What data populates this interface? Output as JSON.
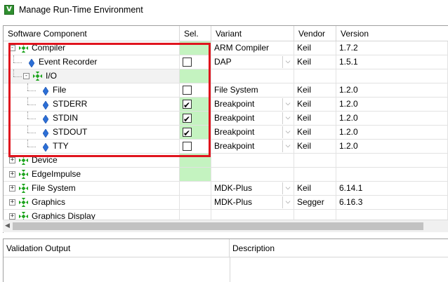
{
  "window": {
    "title": "Manage Run-Time Environment",
    "icon": "keil-v-icon"
  },
  "columns": [
    "Software Component",
    "Sel.",
    "Variant",
    "Vendor",
    "Version"
  ],
  "rows": [
    {
      "name": "Compiler",
      "sel": "",
      "variant": "ARM Compiler",
      "vendor": "Keil",
      "version": "1.7.2"
    },
    {
      "name": "Event Recorder",
      "sel": "unchecked",
      "variant": "DAP",
      "vendor": "Keil",
      "version": "1.5.1"
    },
    {
      "name": "I/O",
      "sel": "",
      "variant": "",
      "vendor": "",
      "version": ""
    },
    {
      "name": "File",
      "sel": "unchecked",
      "variant": "File System",
      "vendor": "Keil",
      "version": "1.2.0"
    },
    {
      "name": "STDERR",
      "sel": "checked",
      "variant": "Breakpoint",
      "vendor": "Keil",
      "version": "1.2.0"
    },
    {
      "name": "STDIN",
      "sel": "checked",
      "variant": "Breakpoint",
      "vendor": "Keil",
      "version": "1.2.0"
    },
    {
      "name": "STDOUT",
      "sel": "checked",
      "variant": "Breakpoint",
      "vendor": "Keil",
      "version": "1.2.0"
    },
    {
      "name": "TTY",
      "sel": "unchecked",
      "variant": "Breakpoint",
      "vendor": "Keil",
      "version": "1.2.0"
    },
    {
      "name": "Device",
      "sel": "",
      "variant": "",
      "vendor": "",
      "version": ""
    },
    {
      "name": "EdgeImpulse",
      "sel": "",
      "variant": "",
      "vendor": "",
      "version": ""
    },
    {
      "name": "File System",
      "sel": "",
      "variant": "MDK-Plus",
      "vendor": "Keil",
      "version": "6.14.1"
    },
    {
      "name": "Graphics",
      "sel": "",
      "variant": "MDK-Plus",
      "vendor": "Segger",
      "version": "6.16.3"
    },
    {
      "name": "Graphics Display",
      "sel": "",
      "variant": "",
      "vendor": "",
      "version": ""
    }
  ],
  "bottom_columns": [
    "Validation Output",
    "Description"
  ],
  "colors": {
    "selected_green": "#c4f3c0",
    "highlight_red": "#e0141e",
    "gem_green": "#1fa51f"
  }
}
